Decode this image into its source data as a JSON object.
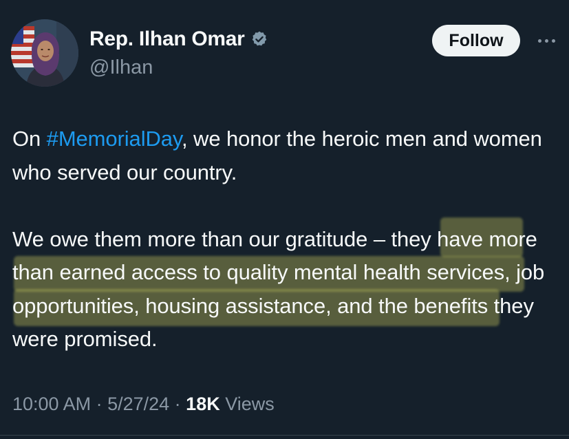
{
  "author": {
    "display_name": "Rep. Ilhan Omar",
    "handle": "@Ilhan",
    "verified_icon": "verified-badge-icon",
    "avatar_icon": "profile-photo"
  },
  "actions": {
    "follow_label": "Follow",
    "more_icon": "more-horizontal-icon"
  },
  "tweet": {
    "p1_before": "On ",
    "p1_hashtag": "#MemorialDay",
    "p1_after": ", we honor the heroic men and women who served our country.",
    "p2": "We owe them more than our gratitude – they have more than earned access to quality mental health services, job opportunities, housing assistance, and the benefits they were promised."
  },
  "meta": {
    "time": "10:00 AM",
    "sep1": " · ",
    "date": "5/27/24",
    "sep2": " · ",
    "views_count": "18K",
    "views_label": " Views"
  },
  "colors": {
    "background": "#15202b",
    "text": "#f7f9f9",
    "secondary": "#8b98a5",
    "link": "#1d9bf0",
    "verified": "#829aab",
    "highlight": "#c4c45c"
  }
}
